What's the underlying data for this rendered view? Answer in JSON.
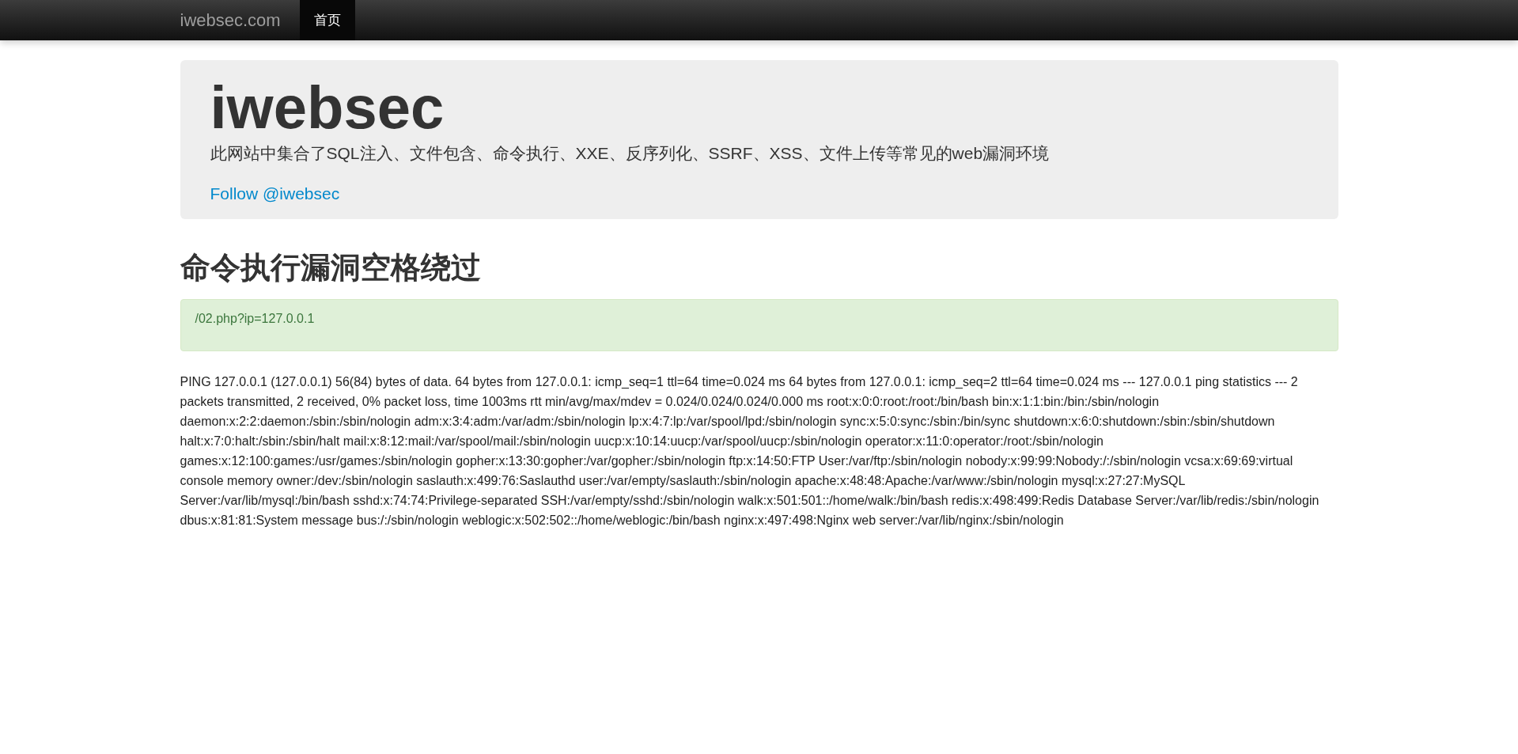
{
  "navbar": {
    "brand": "iwebsec.com",
    "items": [
      {
        "label": "首页",
        "selected": true
      }
    ]
  },
  "jumbotron": {
    "title": "iwebsec",
    "subtitle": "此网站中集合了SQL注入、文件包含、命令执行、XXE、反序列化、SSRF、XSS、文件上传等常见的web漏洞环境",
    "link": "Follow @iwebsec"
  },
  "heading": "命令执行漏洞空格绕过",
  "alert": "/02.php?ip=127.0.0.1",
  "output": "PING 127.0.0.1 (127.0.0.1) 56(84) bytes of data. 64 bytes from 127.0.0.1: icmp_seq=1 ttl=64 time=0.024 ms 64 bytes from 127.0.0.1: icmp_seq=2 ttl=64 time=0.024 ms --- 127.0.0.1 ping statistics --- 2 packets transmitted, 2 received, 0% packet loss, time 1003ms rtt min/avg/max/mdev = 0.024/0.024/0.024/0.000 ms root:x:0:0:root:/root:/bin/bash bin:x:1:1:bin:/bin:/sbin/nologin daemon:x:2:2:daemon:/sbin:/sbin/nologin adm:x:3:4:adm:/var/adm:/sbin/nologin lp:x:4:7:lp:/var/spool/lpd:/sbin/nologin sync:x:5:0:sync:/sbin:/bin/sync shutdown:x:6:0:shutdown:/sbin:/sbin/shutdown halt:x:7:0:halt:/sbin:/sbin/halt mail:x:8:12:mail:/var/spool/mail:/sbin/nologin uucp:x:10:14:uucp:/var/spool/uucp:/sbin/nologin operator:x:11:0:operator:/root:/sbin/nologin games:x:12:100:games:/usr/games:/sbin/nologin gopher:x:13:30:gopher:/var/gopher:/sbin/nologin ftp:x:14:50:FTP User:/var/ftp:/sbin/nologin nobody:x:99:99:Nobody:/:/sbin/nologin vcsa:x:69:69:virtual console memory owner:/dev:/sbin/nologin saslauth:x:499:76:Saslauthd user:/var/empty/saslauth:/sbin/nologin apache:x:48:48:Apache:/var/www:/sbin/nologin mysql:x:27:27:MySQL Server:/var/lib/mysql:/bin/bash sshd:x:74:74:Privilege-separated SSH:/var/empty/sshd:/sbin/nologin walk:x:501:501::/home/walk:/bin/bash redis:x:498:499:Redis Database Server:/var/lib/redis:/sbin/nologin dbus:x:81:81:System message bus:/:/sbin/nologin weblogic:x:502:502::/home/weblogic:/bin/bash nginx:x:497:498:Nginx web server:/var/lib/nginx:/sbin/nologin"
}
